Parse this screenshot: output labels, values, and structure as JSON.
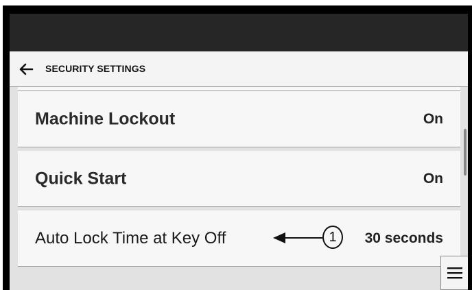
{
  "header": {
    "title": "SECURITY SETTINGS",
    "back_icon": "arrow-left-icon"
  },
  "settings": [
    {
      "label": "Machine Lockout",
      "value": "On"
    },
    {
      "label": "Quick Start",
      "value": "On"
    },
    {
      "label": "Auto Lock Time at Key Off",
      "value": "30 seconds"
    }
  ],
  "callout": {
    "number": "1"
  },
  "menu": {
    "icon": "hamburger-menu-icon"
  }
}
